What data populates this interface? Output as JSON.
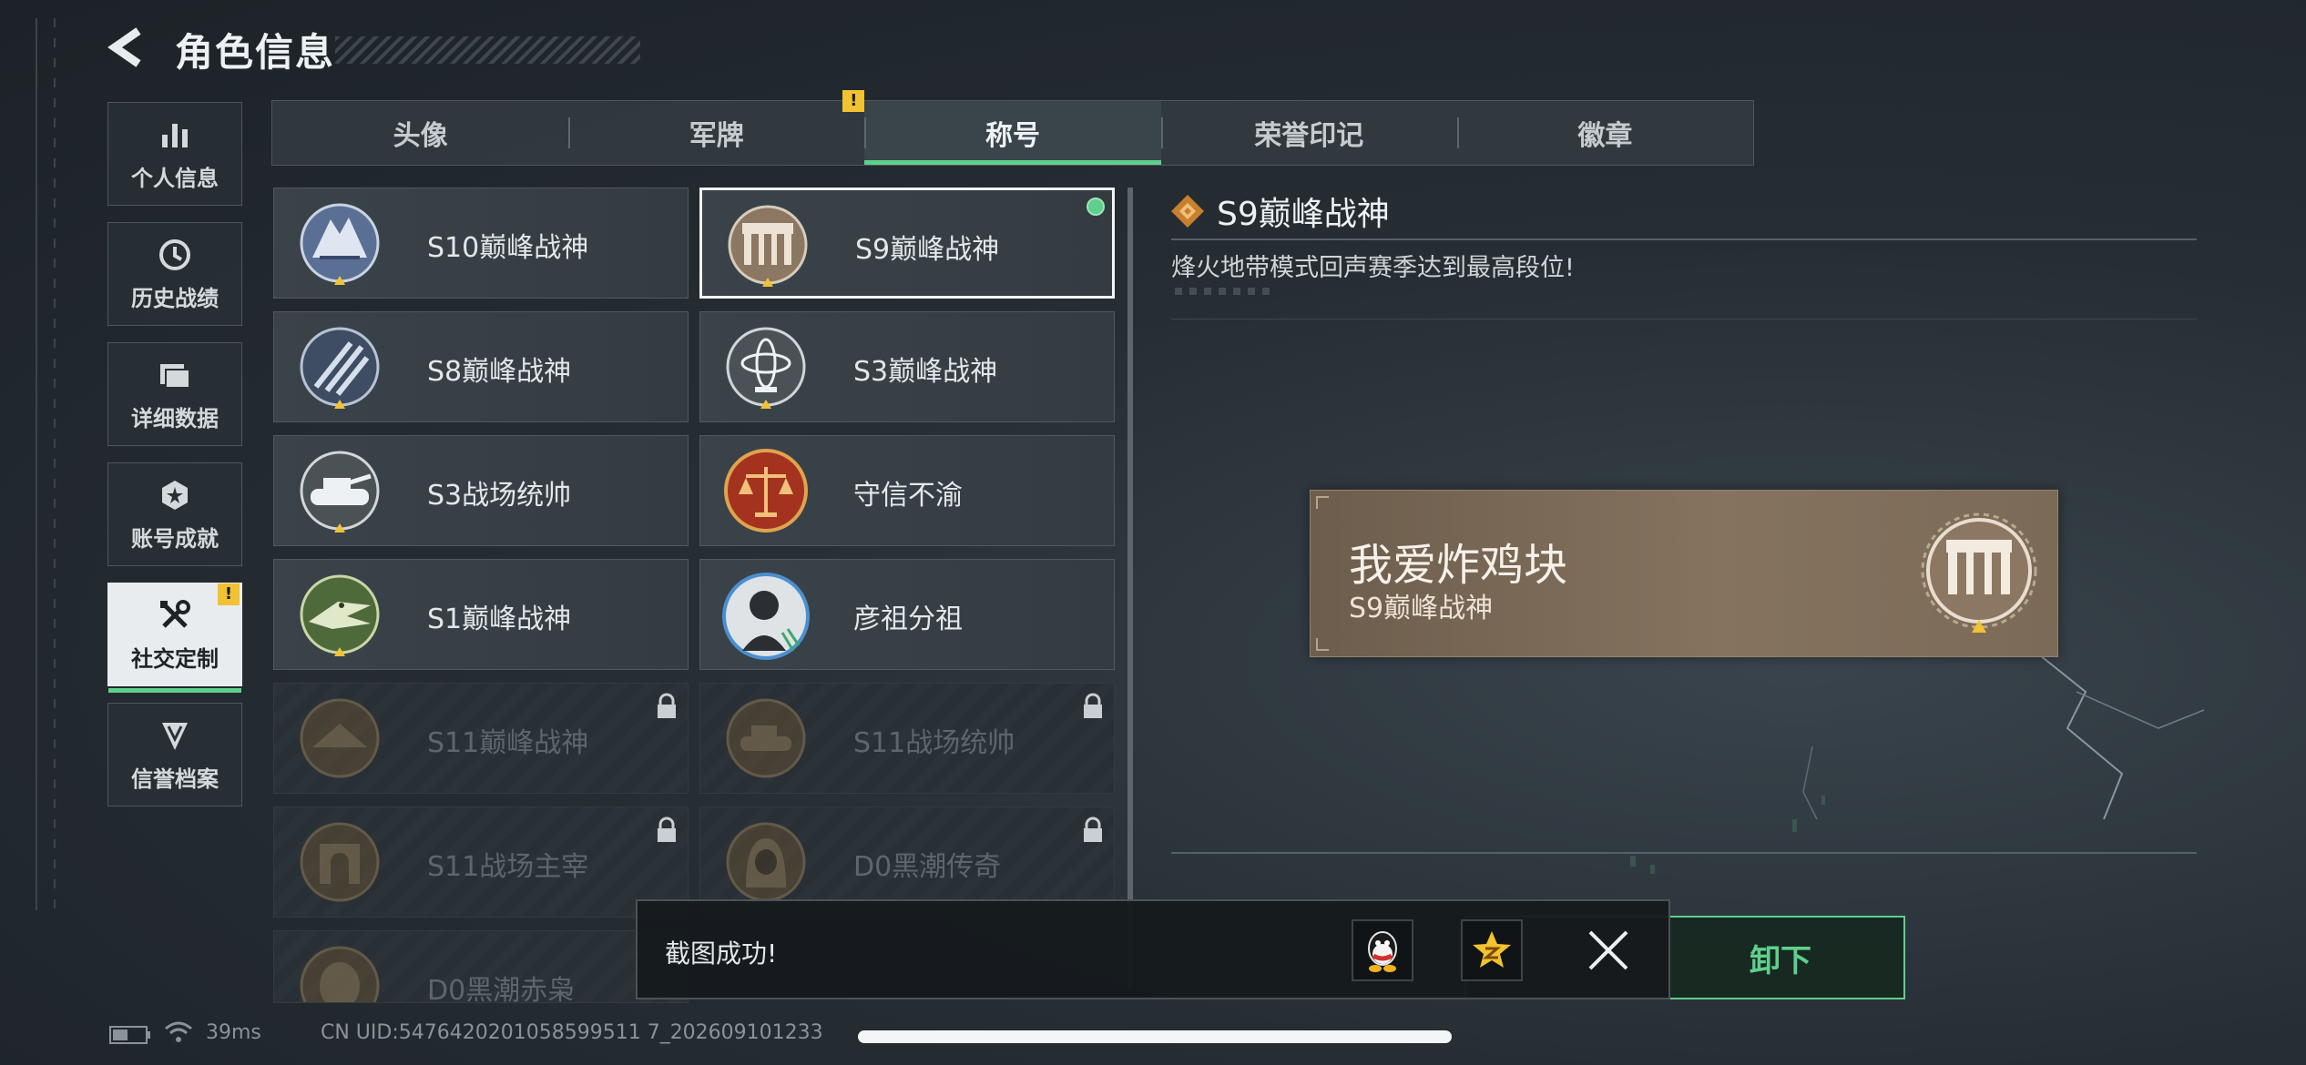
{
  "header": {
    "title": "角色信息"
  },
  "sidebar": {
    "items": [
      {
        "label": "个人信息",
        "icon": "bar-chart-icon",
        "active": false
      },
      {
        "label": "历史战绩",
        "icon": "clock-icon",
        "active": false
      },
      {
        "label": "详细数据",
        "icon": "folder-icon",
        "active": false
      },
      {
        "label": "账号成就",
        "icon": "achievement-icon",
        "active": false
      },
      {
        "label": "社交定制",
        "icon": "tools-icon",
        "active": true,
        "badge": "!"
      },
      {
        "label": "信誉档案",
        "icon": "shield-icon",
        "active": false
      }
    ]
  },
  "tabs": [
    {
      "label": "头像",
      "active": false
    },
    {
      "label": "军牌",
      "active": false,
      "badge": "!"
    },
    {
      "label": "称号",
      "active": true
    },
    {
      "label": "荣誉印记",
      "active": false
    },
    {
      "label": "徽章",
      "active": false
    }
  ],
  "titles": [
    {
      "name": "S10巅峰战神",
      "medal": "ice-peak-medal-icon",
      "locked": false
    },
    {
      "name": "S9巅峰战神",
      "medal": "ruins-medal-icon",
      "locked": false,
      "selected": true,
      "equipped": true
    },
    {
      "name": "S8巅峰战神",
      "medal": "stripes-medal-icon",
      "locked": false
    },
    {
      "name": "S3巅峰战神",
      "medal": "armillary-medal-icon",
      "locked": false
    },
    {
      "name": "S3战场统帅",
      "medal": "tank-medal-icon",
      "locked": false
    },
    {
      "name": "守信不渝",
      "medal": "scales-medal-icon",
      "locked": false
    },
    {
      "name": "S1巅峰战神",
      "medal": "crocodile-medal-icon",
      "locked": false
    },
    {
      "name": "彦祖分祖",
      "medal": "portrait-medal-icon",
      "locked": false
    },
    {
      "name": "S11巅峰战神",
      "medal": "bronze-medal-icon",
      "locked": true
    },
    {
      "name": "S11战场统帅",
      "medal": "bronze-tank-medal-icon",
      "locked": true
    },
    {
      "name": "S11战场主宰",
      "medal": "bronze-arch-medal-icon",
      "locked": true
    },
    {
      "name": "D0黑潮传奇",
      "medal": "hooded-medal-icon",
      "locked": true
    },
    {
      "name": "D0黑潮赤枭",
      "medal": "mask-medal-icon",
      "locked": true
    }
  ],
  "detail": {
    "title": "S9巅峰战神",
    "description": "烽火地带模式回声赛季达到最高段位!",
    "nameplate": {
      "player_name": "我爱炸鸡块",
      "title": "S9巅峰战神"
    },
    "unequip_label": "卸下"
  },
  "toast": {
    "text": "截图成功!",
    "share_icons": [
      "qq-icon",
      "qzone-icon"
    ]
  },
  "status": {
    "ping": "39ms",
    "uid": "CN UID:5476420201058599511 7_202609101233"
  },
  "colors": {
    "accent": "#5fd08b",
    "warning": "#f1c232",
    "nameplate": "#85735f"
  }
}
